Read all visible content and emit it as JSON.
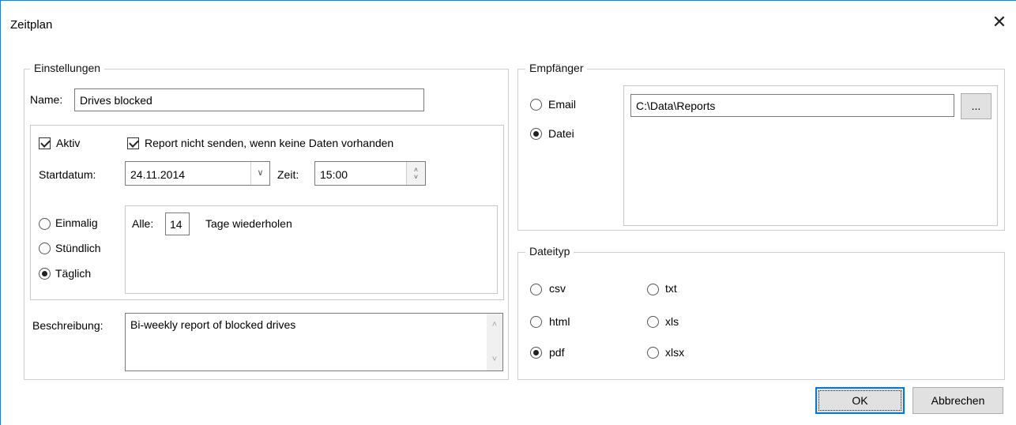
{
  "dialog": {
    "title": "Zeitplan",
    "close_glyph": "✕"
  },
  "settings": {
    "legend": "Einstellungen",
    "name_label": "Name:",
    "name_value": "Drives blocked",
    "aktiv_label": "Aktiv",
    "no_send_label": "Report nicht senden, wenn keine Daten vorhanden",
    "startdate_label": "Startdatum:",
    "startdate_value": "24.11.2014",
    "time_label": "Zeit:",
    "time_value": "15:00",
    "frequency": {
      "options": [
        "Einmalig",
        "Stündlich",
        "Täglich"
      ],
      "selected": "Täglich"
    },
    "repeat": {
      "every_label": "Alle:",
      "every_value": "14",
      "suffix": "Tage wiederholen"
    },
    "description_label": "Beschreibung:",
    "description_value": "Bi-weekly report of blocked drives"
  },
  "recipient": {
    "legend": "Empfänger",
    "options": [
      "Email",
      "Datei"
    ],
    "selected": "Datei",
    "path_value": "C:\\Data\\Reports",
    "browse_label": "..."
  },
  "filetype": {
    "legend": "Dateityp",
    "options": [
      "csv",
      "txt",
      "html",
      "xls",
      "pdf",
      "xlsx"
    ],
    "selected": "pdf"
  },
  "buttons": {
    "ok": "OK",
    "cancel": "Abbrechen"
  }
}
